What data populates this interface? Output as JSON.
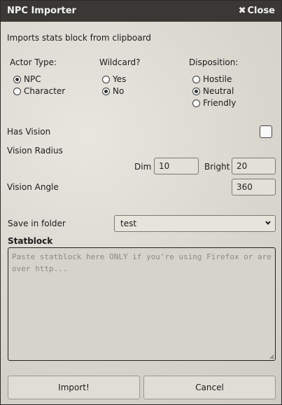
{
  "window": {
    "title": "NPC Importer",
    "close_label": "Close",
    "close_icon": "close-icon"
  },
  "intro": "Imports stats block from clipboard",
  "actor_type": {
    "label": "Actor Type:",
    "options": [
      "NPC",
      "Character"
    ],
    "selected": "NPC"
  },
  "wildcard": {
    "label": "Wildcard?",
    "options": [
      "Yes",
      "No"
    ],
    "selected": "No"
  },
  "disposition": {
    "label": "Disposition:",
    "options": [
      "Hostile",
      "Neutral",
      "Friendly"
    ],
    "selected": "Neutral"
  },
  "vision": {
    "has_vision_label": "Has Vision",
    "has_vision_checked": false,
    "radius_label": "Vision Radius",
    "dim_label": "Dim",
    "dim_value": "10",
    "bright_label": "Bright",
    "bright_value": "20",
    "angle_label": "Vision Angle",
    "angle_value": "360"
  },
  "folder": {
    "label": "Save in folder",
    "selected": "test"
  },
  "statblock": {
    "label": "Statblock",
    "placeholder": "Paste statblock here ONLY if you're using Firefox or are over http..."
  },
  "buttons": {
    "import": "Import!",
    "cancel": "Cancel"
  }
}
